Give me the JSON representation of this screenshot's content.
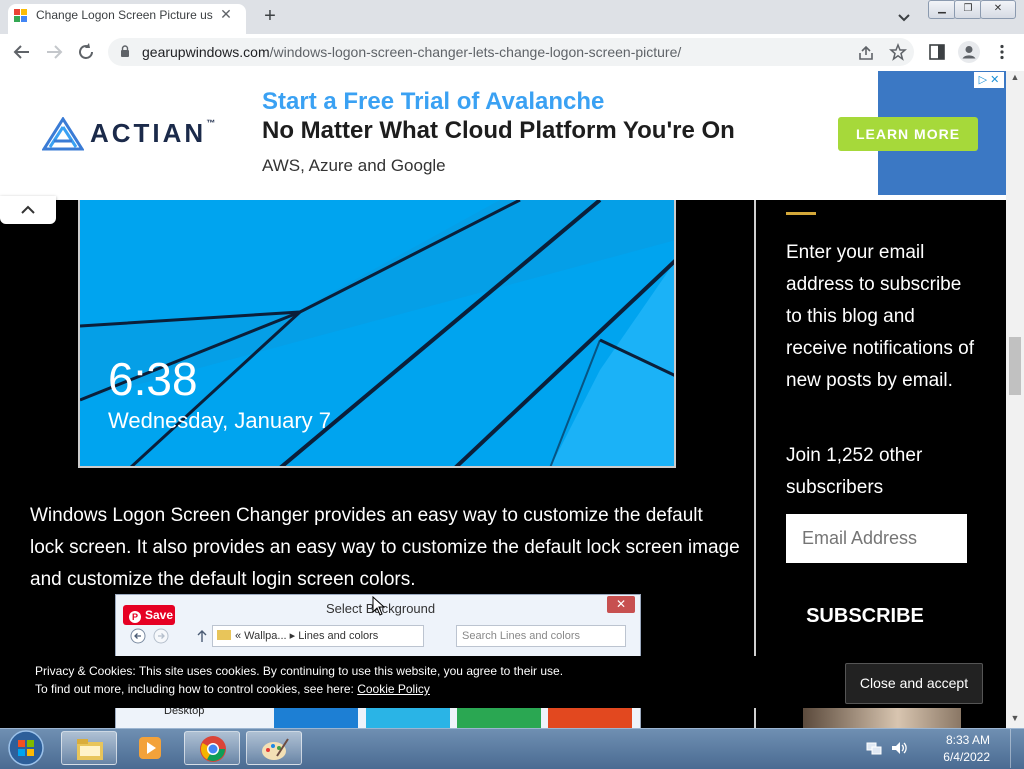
{
  "browser": {
    "tab_title": "Change Logon Screen Picture us",
    "url_domain": "gearupwindows.com",
    "url_path": "/windows-logon-screen-changer-lets-change-logon-screen-picture/",
    "new_tab": "+",
    "tab_close": "✕"
  },
  "ad": {
    "brand": "ACTIAN",
    "trademark": "™",
    "headline1": "Start a Free Trial of Avalanche",
    "headline2": "No Matter What Cloud Platform You're On",
    "subline": "AWS, Azure and Google",
    "cta": "LEARN MORE",
    "choices": "▷ ✕"
  },
  "article": {
    "lock_time": "6:38",
    "lock_date": "Wednesday, January 7",
    "paragraph": "Windows Logon Screen Changer provides an easy way to customize the default lock screen. It also provides an easy way to customize the default lock screen image and customize the default login screen colors."
  },
  "dialog": {
    "title": "Select Background",
    "pin_save": "Save",
    "address": "« Wallpa... ▸ Lines and colors",
    "search_placeholder": "Search Lines and colors",
    "tree_item": "Desktop"
  },
  "sidebar": {
    "subscribe_text": "Enter your email address to subscribe to this blog and receive notifications of new posts by email.",
    "join_text": "Join 1,252 other subscribers",
    "email_placeholder": "Email Address",
    "subscribe_button": "SUBSCRIBE"
  },
  "cookie": {
    "line1": "Privacy & Cookies: This site uses cookies. By continuing to use this website, you agree to their use.",
    "line2_prefix": "To find out more, including how to control cookies, see here: ",
    "link": "Cookie Policy",
    "button": "Close and accept"
  },
  "taskbar": {
    "time": "8:33 AM",
    "date": "6/4/2022"
  },
  "colors": {
    "ad_blue": "#3aa1f3",
    "ad_cta": "#a6d93a",
    "lock_blue": "#00a4ef",
    "pinterest_red": "#e60023",
    "accent_gold": "#d4a83a"
  }
}
